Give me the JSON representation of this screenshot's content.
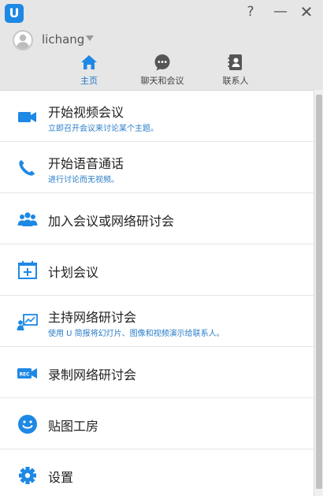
{
  "window": {
    "logo_letter": "U",
    "help_label": "?",
    "minimize_label": "—",
    "close_label": "✕"
  },
  "user": {
    "name": "lichang"
  },
  "tabs": [
    {
      "label": "主页",
      "icon": "home-icon",
      "active": true
    },
    {
      "label": "聊天和会议",
      "icon": "chat-icon",
      "active": false
    },
    {
      "label": "联系人",
      "icon": "contacts-icon",
      "active": false
    }
  ],
  "menu": [
    {
      "title": "开始视频会议",
      "subtitle": "立即召开会议来讨论某个主题。",
      "icon": "video-camera-icon"
    },
    {
      "title": "开始语音通话",
      "subtitle": "进行讨论而无视频。",
      "icon": "phone-icon"
    },
    {
      "title": "加入会议或网络研讨会",
      "icon": "group-icon"
    },
    {
      "title": "计划会议",
      "icon": "calendar-add-icon"
    },
    {
      "title": "主持网络研讨会",
      "subtitle": "使用 U 简报将幻灯片、图像和视频演示给联系人。",
      "icon": "presentation-icon"
    },
    {
      "title": "录制网络研讨会",
      "icon": "record-camera-icon"
    },
    {
      "title": "贴图工房",
      "icon": "smiley-icon"
    },
    {
      "title": "设置",
      "icon": "gear-icon"
    }
  ],
  "colors": {
    "accent": "#1e88e5",
    "active_tab": "#1a73c9",
    "subtitle": "#2a7dc9"
  }
}
